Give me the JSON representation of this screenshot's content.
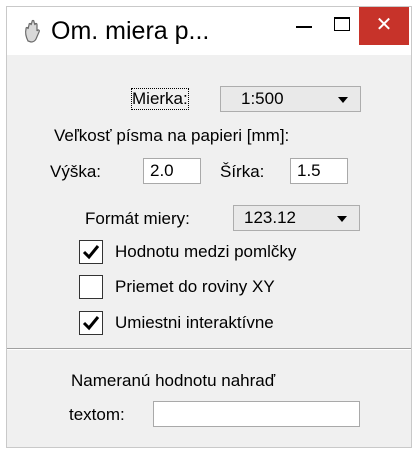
{
  "window": {
    "title": "Om. miera p..."
  },
  "scale": {
    "label": "Mierka:",
    "value": "1:500"
  },
  "font_size": {
    "heading": "Veľkosť písma na papieri [mm]:",
    "height_label": "Výška:",
    "height_value": "2.0",
    "width_label": "Šírka:",
    "width_value": "1.5"
  },
  "format": {
    "label": "Formát miery:",
    "value": "123.12"
  },
  "options": [
    {
      "label": "Hodnotu medzi pomlčky",
      "checked": true
    },
    {
      "label": "Priemet do roviny XY",
      "checked": false
    },
    {
      "label": "Umiestni interaktívne",
      "checked": true
    }
  ],
  "replace": {
    "label_line1": "Nameranú  hodnotu  nahraď",
    "label_line2": "textom:",
    "value": ""
  },
  "colors": {
    "close_button": "#c7332a",
    "window_bg": "#f0f0f0"
  }
}
